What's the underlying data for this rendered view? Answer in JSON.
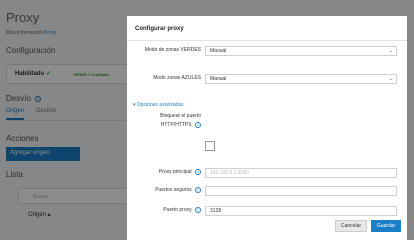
{
  "background": {
    "title": "Proxy",
    "more_info_prefix": "Más información",
    "more_info_link": "Proxy",
    "section_config": "Configuración",
    "enabled_label": "Habilitado",
    "enabled_badge": "VERDE Y Confiable",
    "section_desvio": "Desvío",
    "tab_origen": "Origen",
    "tab_destino": "Destino",
    "section_acciones": "Acciones",
    "add_origin_button": "Agregar origen",
    "section_lista": "Lista",
    "search_placeholder": "Buscar",
    "col_origen": "Origen ▴"
  },
  "modal": {
    "title": "Configurar proxy",
    "green_zone_label": "Modo de zonas VERDES",
    "green_zone_value": "Manual",
    "blue_zone_label": "Modo zonas AZULES",
    "blue_zone_value": "Manual",
    "advanced_toggle": "Opciones avanzadas",
    "block_http_label": "Bloquear el puerto HTTP/HTTPS",
    "main_proxy_label": "Proxy principal",
    "main_proxy_placeholder": "192.168.0.1:8080",
    "secure_ports_label": "Puertos seguros",
    "proxy_port_label": "Puerto proxy",
    "proxy_port_value": "3128",
    "cancel_button": "Cancelar",
    "save_button": "Guardar"
  },
  "colors": {
    "accent": "#1a7fc9",
    "green": "#2ca02c"
  }
}
